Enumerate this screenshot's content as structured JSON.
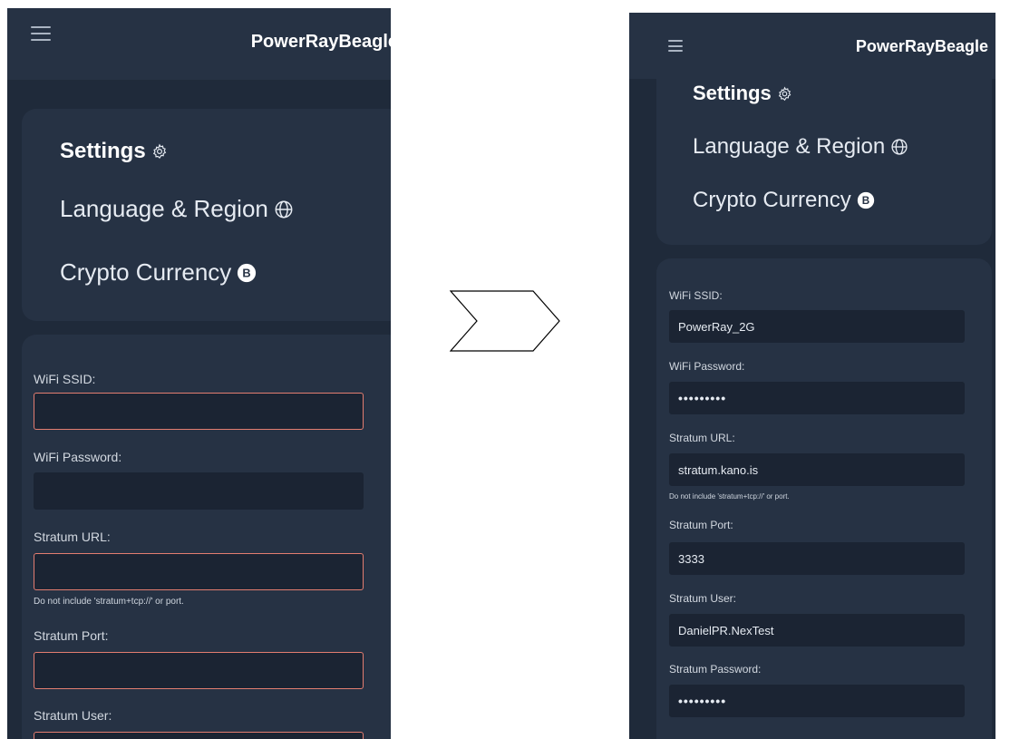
{
  "left": {
    "header": {
      "title": "PowerRayBeagle",
      "menu_icon": "hamburger-menu-icon"
    },
    "settings_menu": [
      {
        "label": "Settings",
        "icon": "gear-icon"
      },
      {
        "label": "Language & Region",
        "icon": "globe-icon"
      },
      {
        "label": "Crypto Currency",
        "icon": "bitcoin-icon"
      }
    ],
    "form": {
      "wifi_ssid": {
        "label": "WiFi SSID:",
        "value": ""
      },
      "wifi_password": {
        "label": "WiFi Password:",
        "value": ""
      },
      "stratum_url": {
        "label": "Stratum URL:",
        "value": "",
        "hint": "Do not include 'stratum+tcp://' or port."
      },
      "stratum_port": {
        "label": "Stratum Port:",
        "value": ""
      },
      "stratum_user": {
        "label": "Stratum User:",
        "value": ""
      }
    }
  },
  "right": {
    "header": {
      "title": "PowerRayBeagle",
      "menu_icon": "hamburger-menu-icon"
    },
    "settings_menu": [
      {
        "label": "Settings",
        "icon": "gear-icon"
      },
      {
        "label": "Language & Region",
        "icon": "globe-icon"
      },
      {
        "label": "Crypto Currency",
        "icon": "bitcoin-icon"
      }
    ],
    "form": {
      "wifi_ssid": {
        "label": "WiFi SSID:",
        "value": "PowerRay_2G"
      },
      "wifi_password": {
        "label": "WiFi Password:",
        "value": "•••••••••"
      },
      "stratum_url": {
        "label": "Stratum URL:",
        "value": "stratum.kano.is",
        "hint": "Do not include 'stratum+tcp://' or port."
      },
      "stratum_port": {
        "label": "Stratum Port:",
        "value": "3333"
      },
      "stratum_user": {
        "label": "Stratum User:",
        "value": "DanielPR.NexTest"
      },
      "stratum_password": {
        "label": "Stratum Password:",
        "value": "•••••••••"
      }
    }
  },
  "transition_arrow_icon": "chevron-right-arrow-icon",
  "colors": {
    "background": "#1f2a3a",
    "card": "#263244",
    "input": "#1b2433",
    "error_border": "#e37d70",
    "text": "#e6ebf2"
  }
}
